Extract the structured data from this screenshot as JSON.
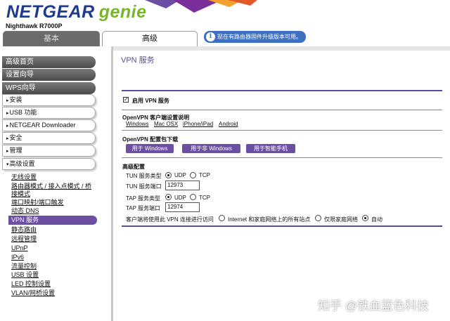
{
  "header": {
    "brand": "NETGEAR",
    "genie": "genie",
    "model": "Nighthawk R7000P",
    "tabs": {
      "basic": "基本",
      "advanced": "高级"
    },
    "update_notice": "现在有路由器固件升级版本可用。",
    "info_icon": "i"
  },
  "sidebar": {
    "main_items": [
      "高级首页",
      "设置向导",
      "WPS向导"
    ],
    "groups": [
      "安装",
      "USB 功能",
      "NETGEAR Downloader (BETA)",
      "安全",
      "管理",
      "高级设置"
    ],
    "group_arrow": "▸",
    "group_arrow_open": "▾",
    "sub_items": [
      "无线设置",
      "路由器模式 / 接入点模式 / 桥接模式",
      "端口映射/端口触发",
      "动态 DNS",
      "VPN 服务",
      "静态路由",
      "远程管理",
      "UPnP",
      "IPv6",
      "流量控制",
      "USB 设置",
      "LED 控制设置",
      "VLAN/网桥设置"
    ],
    "active_sub_item": "VPN 服务"
  },
  "main": {
    "title": "VPN 服务",
    "enable_vpn_label": "启用 VPN 服务",
    "enable_vpn_checked": true,
    "client_setup_title": "OpenVPN 客户端设置说明",
    "client_links": [
      "Windows",
      "Mac OSX",
      "iPhone/iPad",
      "Android"
    ],
    "config_title": "OpenVPN 配置包下载",
    "config_buttons": [
      "用于 Windows",
      "用于非 Windows",
      "用于智能手机"
    ],
    "advanced_title": "高级配置",
    "tun_type_label": "TUN 服务类型",
    "tun_port_label": "TUN 服务端口",
    "tun_port_value": "12973",
    "tap_type_label": "TAP 服务类型",
    "tap_port_label": "TAP 服务端口",
    "tap_port_value": "12974",
    "protocol_options": [
      "UDP",
      "TCP"
    ],
    "tun_protocol_selected": "UDP",
    "tap_protocol_selected": "UDP",
    "access_label": "客户端将使用此 VPN 连接进行访问",
    "access_options": [
      "Internet 和家庭网络上的所有站点",
      "仅限家庭网络",
      "自动"
    ],
    "access_selected": "自动"
  },
  "watermark": "知乎 @铁血蓝色科技",
  "colors": {
    "accent_purple": "#6c4fa3",
    "brand_blue": "#1b3b8f",
    "genie_green": "#77b62a",
    "notice_blue": "#3f70c0"
  }
}
